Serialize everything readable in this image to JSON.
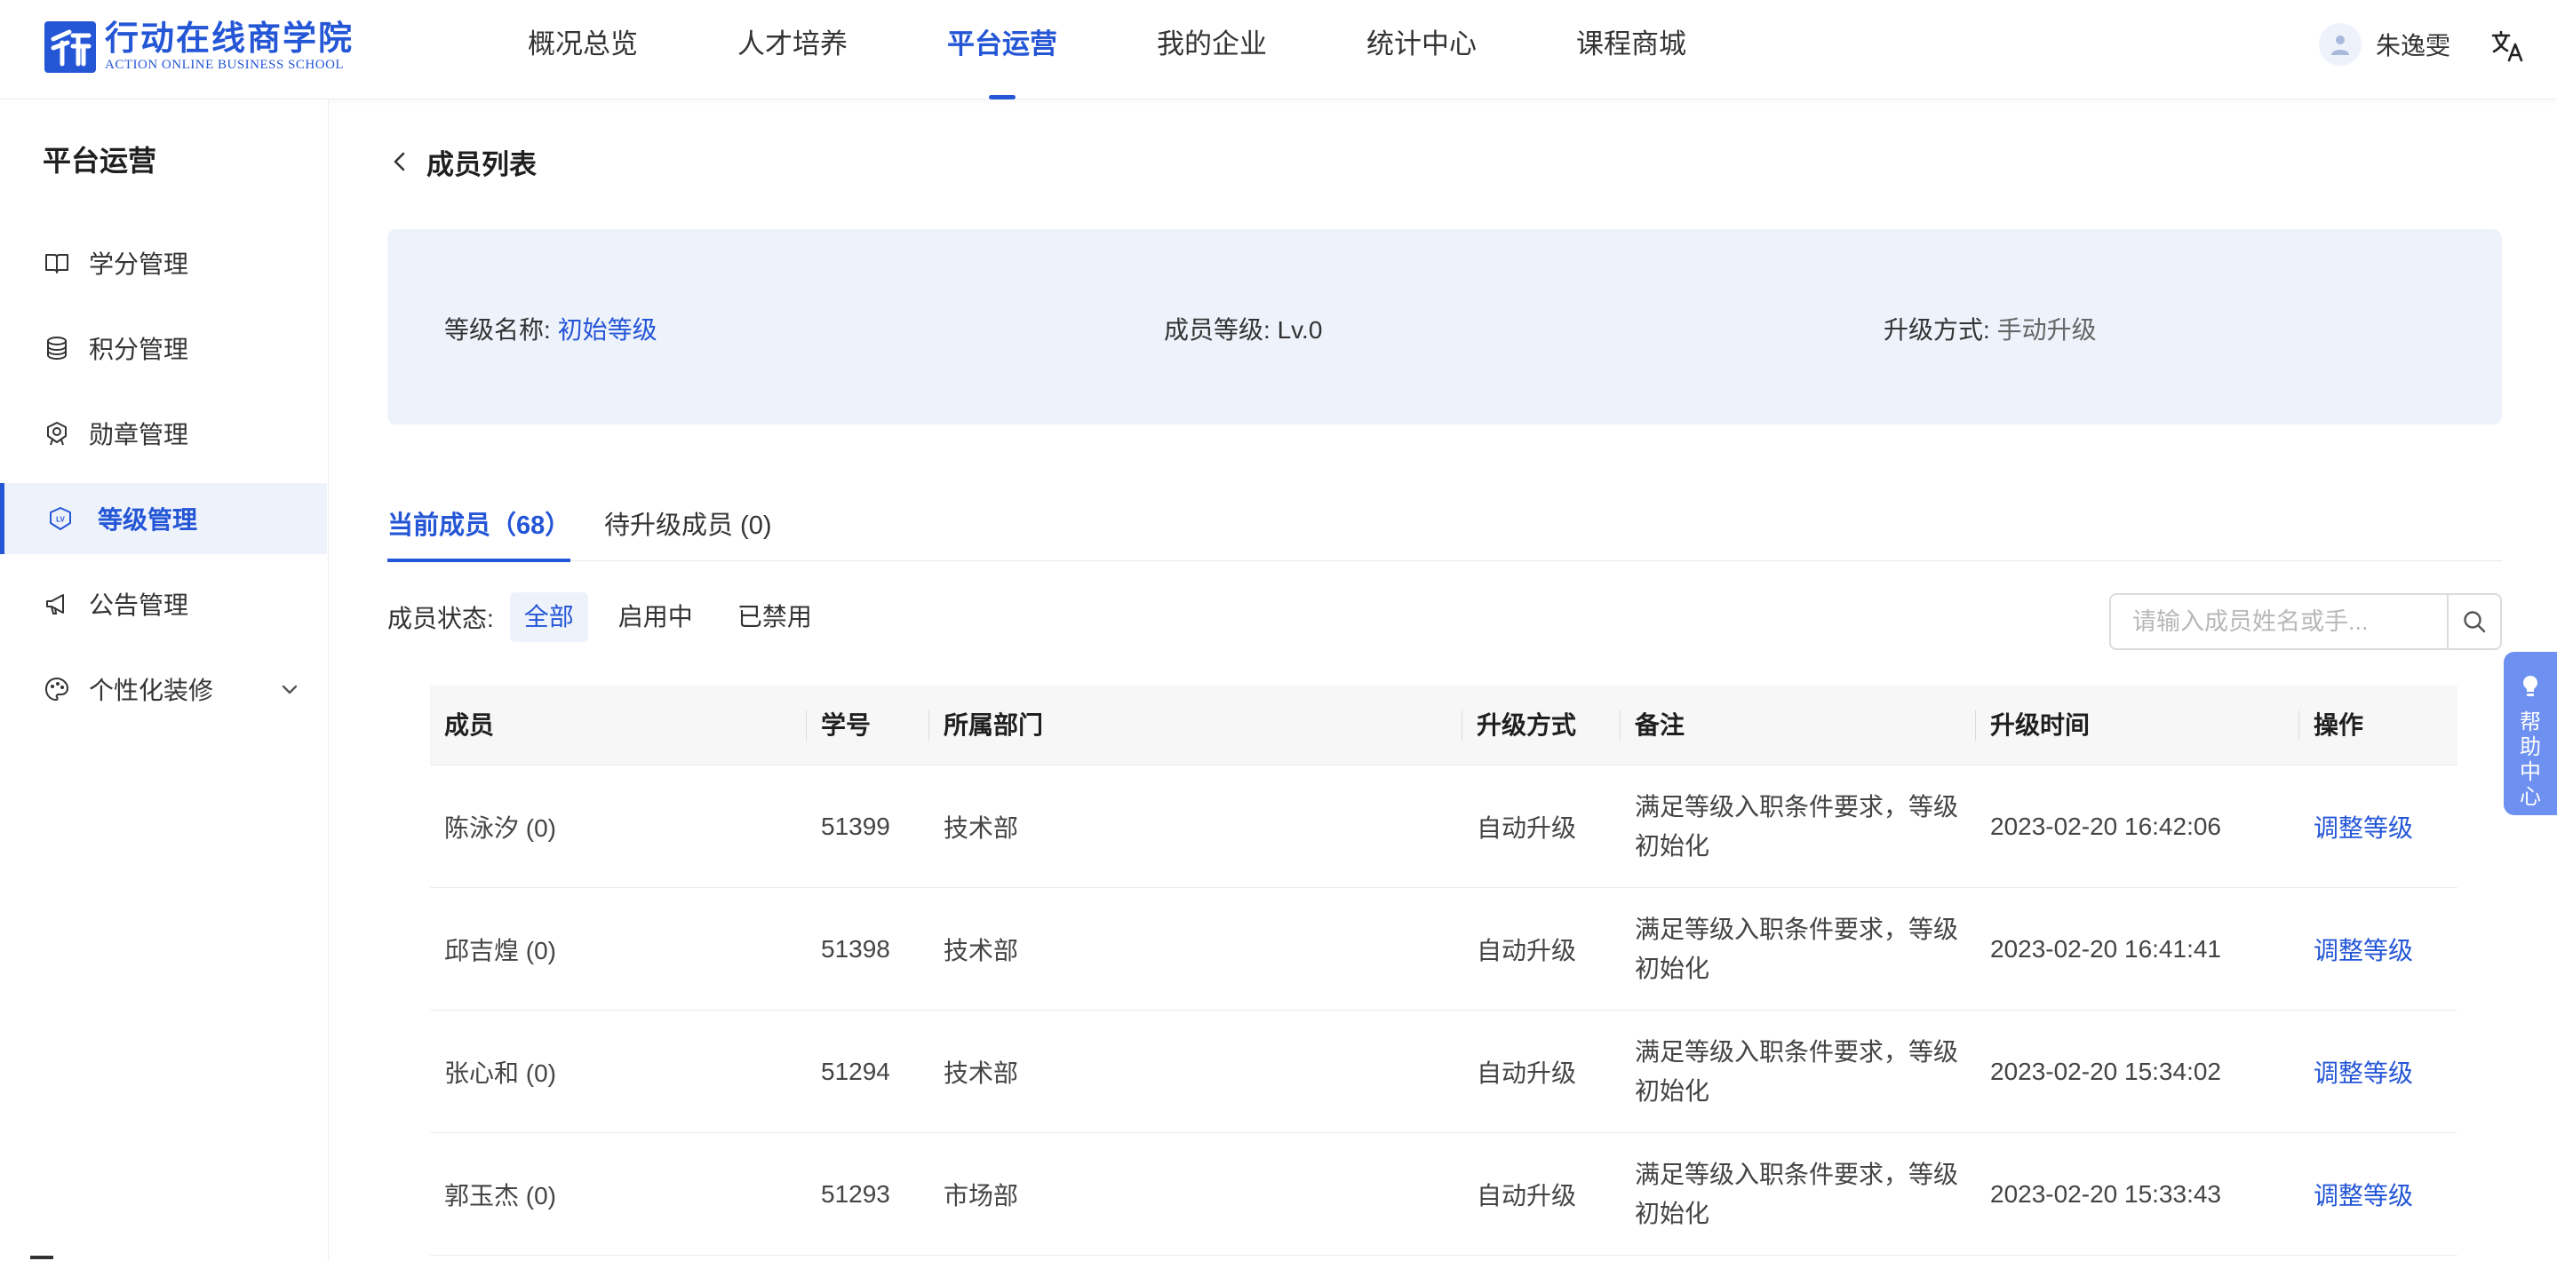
{
  "brand": {
    "name_cn": "行动在线商学院",
    "name_en": "ACTION ONLINE BUSINESS SCHOOL",
    "color": "#2456d6"
  },
  "nav": {
    "items": [
      {
        "label": "概况总览",
        "active": false
      },
      {
        "label": "人才培养",
        "active": false
      },
      {
        "label": "平台运营",
        "active": true
      },
      {
        "label": "我的企业",
        "active": false
      },
      {
        "label": "统计中心",
        "active": false
      },
      {
        "label": "课程商城",
        "active": false
      }
    ]
  },
  "user": {
    "name": "朱逸雯",
    "avatar_icon": "user-avatar-icon",
    "lang_icon": "translate-icon"
  },
  "sidebar": {
    "title": "平台运营",
    "items": [
      {
        "label": "学分管理",
        "icon": "book-icon"
      },
      {
        "label": "积分管理",
        "icon": "coins-icon"
      },
      {
        "label": "勋章管理",
        "icon": "medal-icon"
      },
      {
        "label": "等级管理",
        "icon": "level-badge-icon",
        "active": true
      },
      {
        "label": "公告管理",
        "icon": "megaphone-icon"
      },
      {
        "label": "个性化装修",
        "icon": "palette-icon",
        "expandable": true
      }
    ]
  },
  "page": {
    "title": "成员列表"
  },
  "info": {
    "level_name_label": "等级名称:",
    "level_name_value": "初始等级",
    "member_level_label": "成员等级:",
    "member_level_value": "Lv.0",
    "upgrade_label": "升级方式:",
    "upgrade_value": "手动升级"
  },
  "tabs": [
    {
      "label": "当前成员（68）",
      "active": true
    },
    {
      "label": "待升级成员 (0)",
      "active": false
    }
  ],
  "filter": {
    "label": "成员状态:",
    "options": [
      {
        "label": "全部",
        "active": true
      },
      {
        "label": "启用中",
        "active": false
      },
      {
        "label": "已禁用",
        "active": false
      }
    ]
  },
  "search": {
    "placeholder": "请输入成员姓名或手...",
    "value": ""
  },
  "table": {
    "columns": [
      "成员",
      "学号",
      "所属部门",
      "升级方式",
      "备注",
      "升级时间",
      "操作"
    ],
    "rows": [
      {
        "member": "陈泳汐 (0)",
        "id": "51399",
        "dept": "技术部",
        "method": "自动升级",
        "note": "满足等级入职条件要求，等级初始化",
        "time": "2023-02-20 16:42:06",
        "action": "调整等级"
      },
      {
        "member": "邱吉煌 (0)",
        "id": "51398",
        "dept": "技术部",
        "method": "自动升级",
        "note": "满足等级入职条件要求，等级初始化",
        "time": "2023-02-20 16:41:41",
        "action": "调整等级"
      },
      {
        "member": "张心和 (0)",
        "id": "51294",
        "dept": "技术部",
        "method": "自动升级",
        "note": "满足等级入职条件要求，等级初始化",
        "time": "2023-02-20 15:34:02",
        "action": "调整等级"
      },
      {
        "member": "郭玉杰 (0)",
        "id": "51293",
        "dept": "市场部",
        "method": "自动升级",
        "note": "满足等级入职条件要求，等级初始化",
        "time": "2023-02-20 15:33:43",
        "action": "调整等级"
      }
    ]
  },
  "help": {
    "label": "帮助中心",
    "icon": "lightbulb-icon",
    "color": "#6e90f0"
  }
}
